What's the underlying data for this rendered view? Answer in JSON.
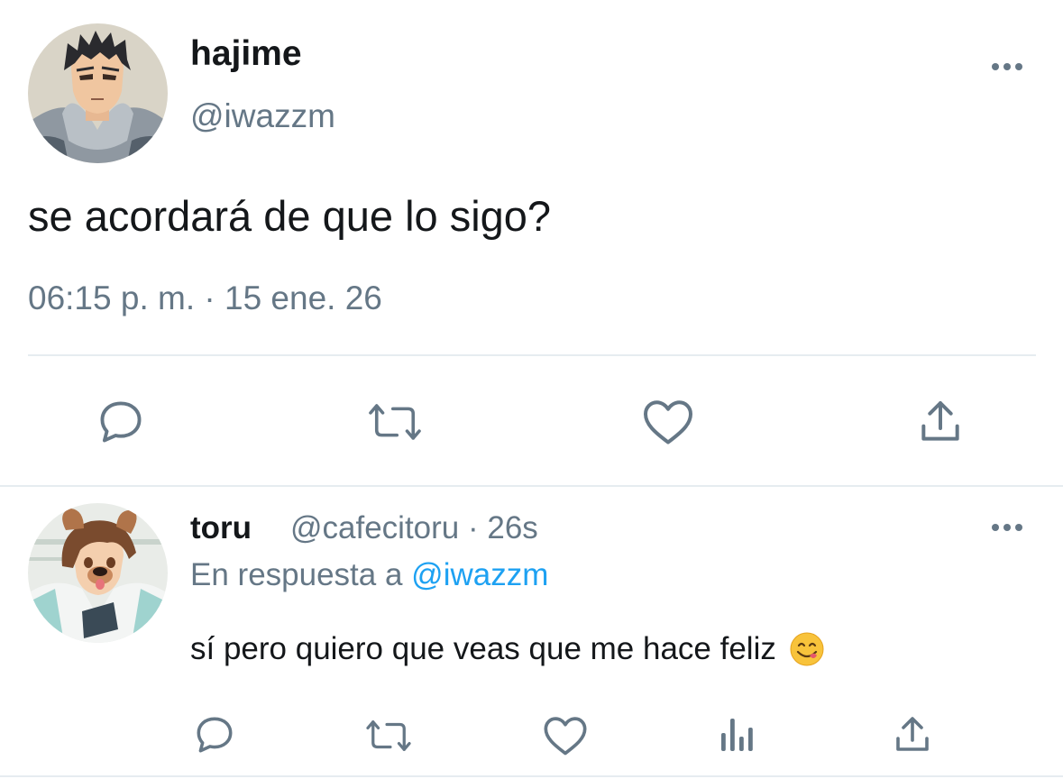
{
  "tweet": {
    "author_name": "hajime",
    "author_handle": "@iwazzm",
    "text": "se acordará de que lo sigo?",
    "timestamp": "06:15 p. m. · 15 ene. 26",
    "actions": [
      {
        "name": "reply-icon"
      },
      {
        "name": "retweet-icon"
      },
      {
        "name": "like-icon"
      },
      {
        "name": "share-icon"
      }
    ]
  },
  "reply": {
    "author_name": "toru",
    "meta": "@cafecitoru · 26s",
    "reply_prefix": "En respuesta a",
    "reply_mention": "@iwazzm",
    "text": "sí pero quiero que veas que me hace feliz",
    "emoji": "face-savoring-food",
    "actions": [
      {
        "name": "reply-icon"
      },
      {
        "name": "retweet-icon"
      },
      {
        "name": "like-icon"
      },
      {
        "name": "analytics-icon"
      },
      {
        "name": "share-icon"
      }
    ]
  },
  "colors": {
    "text_primary": "#14171a",
    "text_secondary": "#657786",
    "link": "#1da1f2",
    "icon": "#657786",
    "divider": "#e6ecf0"
  }
}
